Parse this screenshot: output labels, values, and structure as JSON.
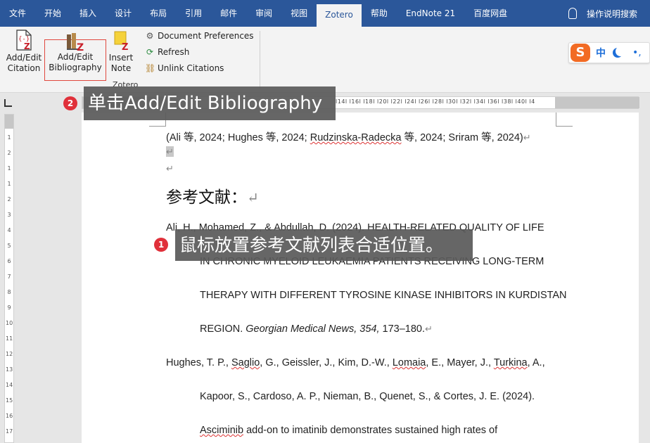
{
  "tabs": [
    "文件",
    "开始",
    "插入",
    "设计",
    "布局",
    "引用",
    "邮件",
    "审阅",
    "视图",
    "Zotero",
    "帮助",
    "EndNote 21",
    "百度网盘"
  ],
  "active_tab": "Zotero",
  "tell_me": "操作说明搜索",
  "ribbon": {
    "add_edit_citation": [
      "Add/Edit",
      "Citation"
    ],
    "add_edit_bibliography": [
      "Add/Edit",
      "Bibliography"
    ],
    "insert_note": [
      "Insert",
      "Note"
    ],
    "document_preferences": "Document Preferences",
    "refresh": "Refresh",
    "unlink_citations": "Unlink Citations",
    "group_label": "Zotero"
  },
  "ime": {
    "logo": "S",
    "mode": "中",
    "dots": "•,"
  },
  "ruler": {
    "h_numbers": "l14l  l16l  l18l  l20l  l22l  l24l  l26l  l28l  l30l  l32l  l34l  l36l  l38l  l40l  l4",
    "v_numbers": [
      "1",
      "2",
      "1",
      "1",
      "2",
      "3",
      "4",
      "5",
      "6",
      "7",
      "8",
      "9",
      "10",
      "11",
      "12",
      "13",
      "14",
      "15",
      "16",
      "17",
      "18"
    ]
  },
  "document": {
    "citation_line": [
      "(Ali 等, 2024; Hughes 等, 2024; ",
      "Rudzinska-Radecka",
      " 等, 2024; Sriram 等, 2024)"
    ],
    "para_mark": "↵",
    "heading": "参考文献：",
    "ref1": [
      "Ali, H., Mohamed, Z., & Abdullah, D. (2024). HEALTH-RELATED QUALITY OF LIFE",
      "IN CHRONIC MYELOID LEUKAEMIA PATIENTS RECEIVING LONG-TERM",
      "THERAPY WITH DIFFERENT TYROSINE KINASE INHIBITORS IN KURDISTAN"
    ],
    "ref1_last": {
      "a": "REGION. ",
      "journal": "Georgian Medical News, 354,",
      "pages": " 173–180."
    },
    "ref2_line1": [
      "Hughes, T. P., ",
      "Saglio",
      ", G., Geissler, J., Kim, D.-W., ",
      "Lomaia",
      ", E., Mayer, J., ",
      "Turkina",
      ", A.,"
    ],
    "ref2_line2": "Kapoor, S., Cardoso, A. P., Nieman, B., Quenet, S., & Cortes, J. E. (2024).",
    "ref2_line3": [
      "Asciminib",
      " add-on to imatinib demonstrates sustained high rates of"
    ]
  },
  "callouts": {
    "step1": {
      "num": "1",
      "text": "鼠标放置参考文献列表合适位置。"
    },
    "step2": {
      "num": "2",
      "text": "单击Add/Edit Bibliography"
    }
  },
  "colors": {
    "ribbon_blue": "#2b579a",
    "highlight": "#e0483e",
    "badge": "#e0303a",
    "zotero_red": "#c8202a"
  }
}
